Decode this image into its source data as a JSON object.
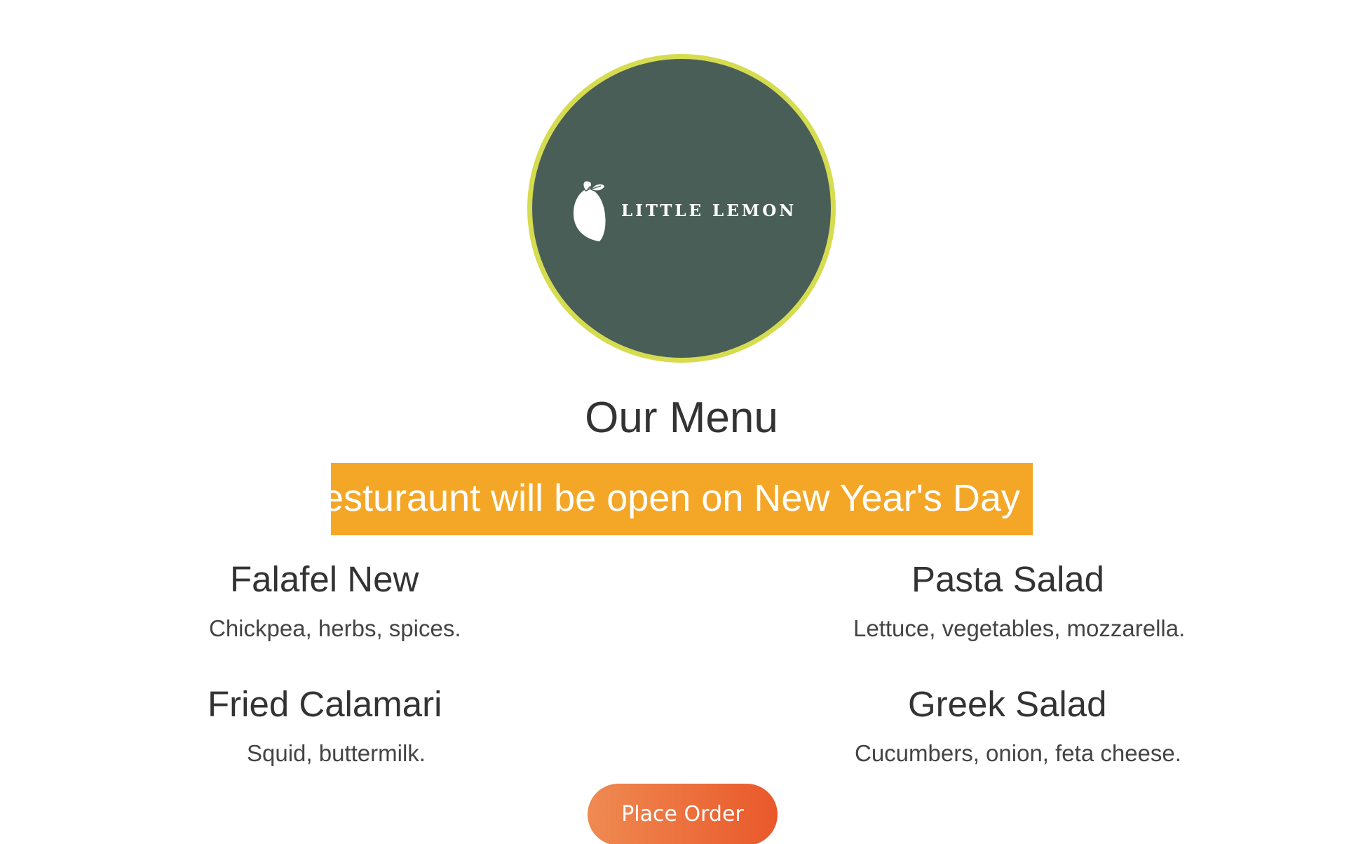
{
  "logo": {
    "brand": "LITTLE LEMON",
    "icon": "lemon-icon",
    "background_color": "#495e57",
    "ring_color": "#d6dc4f"
  },
  "heading": "Our Menu",
  "announcement": {
    "text": "Our resturaunt will be open on New Year's Day",
    "background_color": "#f4a727"
  },
  "dishes": [
    {
      "name": "Falafel New",
      "description": "Chickpea, herbs, spices."
    },
    {
      "name": "Pasta Salad",
      "description": "Lettuce, vegetables, mozzarella."
    },
    {
      "name": "Fried Calamari",
      "description": "Squid, buttermilk."
    },
    {
      "name": "Greek Salad",
      "description": "Cucumbers, onion, feta cheese."
    }
  ],
  "order_button": {
    "label": "Place Order"
  }
}
